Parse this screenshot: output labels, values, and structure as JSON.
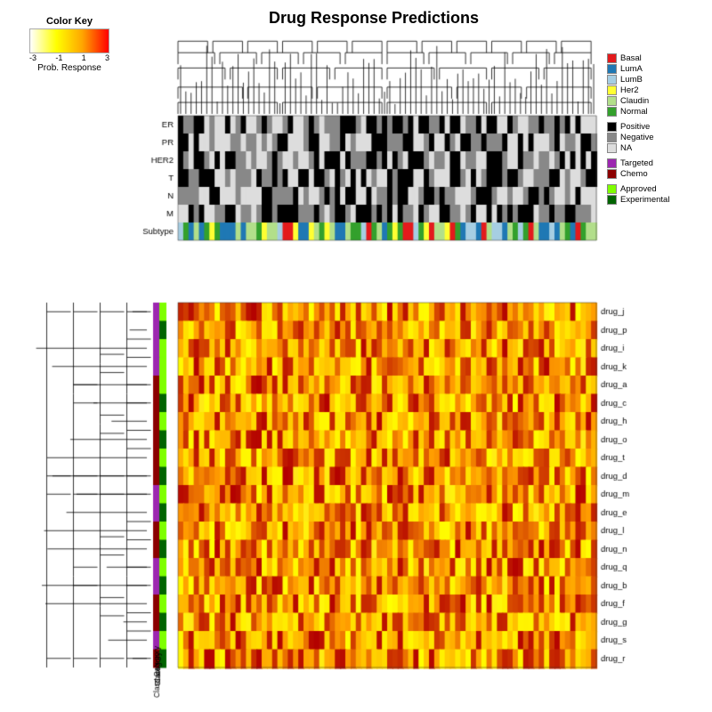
{
  "title": "Drug Response Predictions",
  "colorKey": {
    "title": "Color Key",
    "labels": [
      "-3",
      "-1",
      "1",
      "3"
    ],
    "axisLabel": "Prob. Response"
  },
  "legend": {
    "subtype": [
      {
        "label": "Basal",
        "color": "#e31a1c"
      },
      {
        "label": "LumA",
        "color": "#1f78b4"
      },
      {
        "label": "LumB",
        "color": "#a6cee3"
      },
      {
        "label": "Her2",
        "color": "#ffff33"
      },
      {
        "label": "Claudin",
        "color": "#b2df8a"
      },
      {
        "label": "Normal",
        "color": "#33a02c"
      }
    ],
    "status": [
      {
        "label": "Positive",
        "color": "#000000"
      },
      {
        "label": "Negative",
        "color": "#888888"
      },
      {
        "label": "NA",
        "color": "#dddddd"
      }
    ],
    "drugClass": [
      {
        "label": "Targeted",
        "color": "#9c27b0"
      },
      {
        "label": "Chemo",
        "color": "#8b0000"
      }
    ],
    "approval": [
      {
        "label": "Approved",
        "color": "#7fff00"
      },
      {
        "label": "Experimental",
        "color": "#006400"
      }
    ]
  },
  "drugs": [
    "drug_j",
    "drug_p",
    "drug_i",
    "drug_k",
    "drug_a",
    "drug_c",
    "drug_h",
    "drug_o",
    "drug_t",
    "drug_d",
    "drug_m",
    "drug_e",
    "drug_l",
    "drug_n",
    "drug_q",
    "drug_b",
    "drug_f",
    "drug_g",
    "drug_s",
    "drug_r"
  ],
  "annotationRows": [
    "ER",
    "PR",
    "HER2",
    "T",
    "N",
    "M",
    "Subtype"
  ],
  "drugCategories": {
    "drug_j": {
      "class": "targeted",
      "approval": "approved"
    },
    "drug_p": {
      "class": "targeted",
      "approval": "experimental"
    },
    "drug_i": {
      "class": "targeted",
      "approval": "approved"
    },
    "drug_k": {
      "class": "targeted",
      "approval": "approved"
    },
    "drug_a": {
      "class": "chemo",
      "approval": "approved"
    },
    "drug_c": {
      "class": "chemo",
      "approval": "experimental"
    },
    "drug_h": {
      "class": "chemo",
      "approval": "approved"
    },
    "drug_o": {
      "class": "chemo",
      "approval": "experimental"
    },
    "drug_t": {
      "class": "chemo",
      "approval": "approved"
    },
    "drug_d": {
      "class": "chemo",
      "approval": "experimental"
    },
    "drug_m": {
      "class": "targeted",
      "approval": "approved"
    },
    "drug_e": {
      "class": "targeted",
      "approval": "experimental"
    },
    "drug_l": {
      "class": "chemo",
      "approval": "approved"
    },
    "drug_n": {
      "class": "chemo",
      "approval": "experimental"
    },
    "drug_q": {
      "class": "targeted",
      "approval": "approved"
    },
    "drug_b": {
      "class": "targeted",
      "approval": "experimental"
    },
    "drug_f": {
      "class": "chemo",
      "approval": "approved"
    },
    "drug_g": {
      "class": "chemo",
      "approval": "experimental"
    },
    "drug_s": {
      "class": "targeted",
      "approval": "approved"
    },
    "drug_r": {
      "class": "chemo",
      "approval": "experimental"
    }
  }
}
